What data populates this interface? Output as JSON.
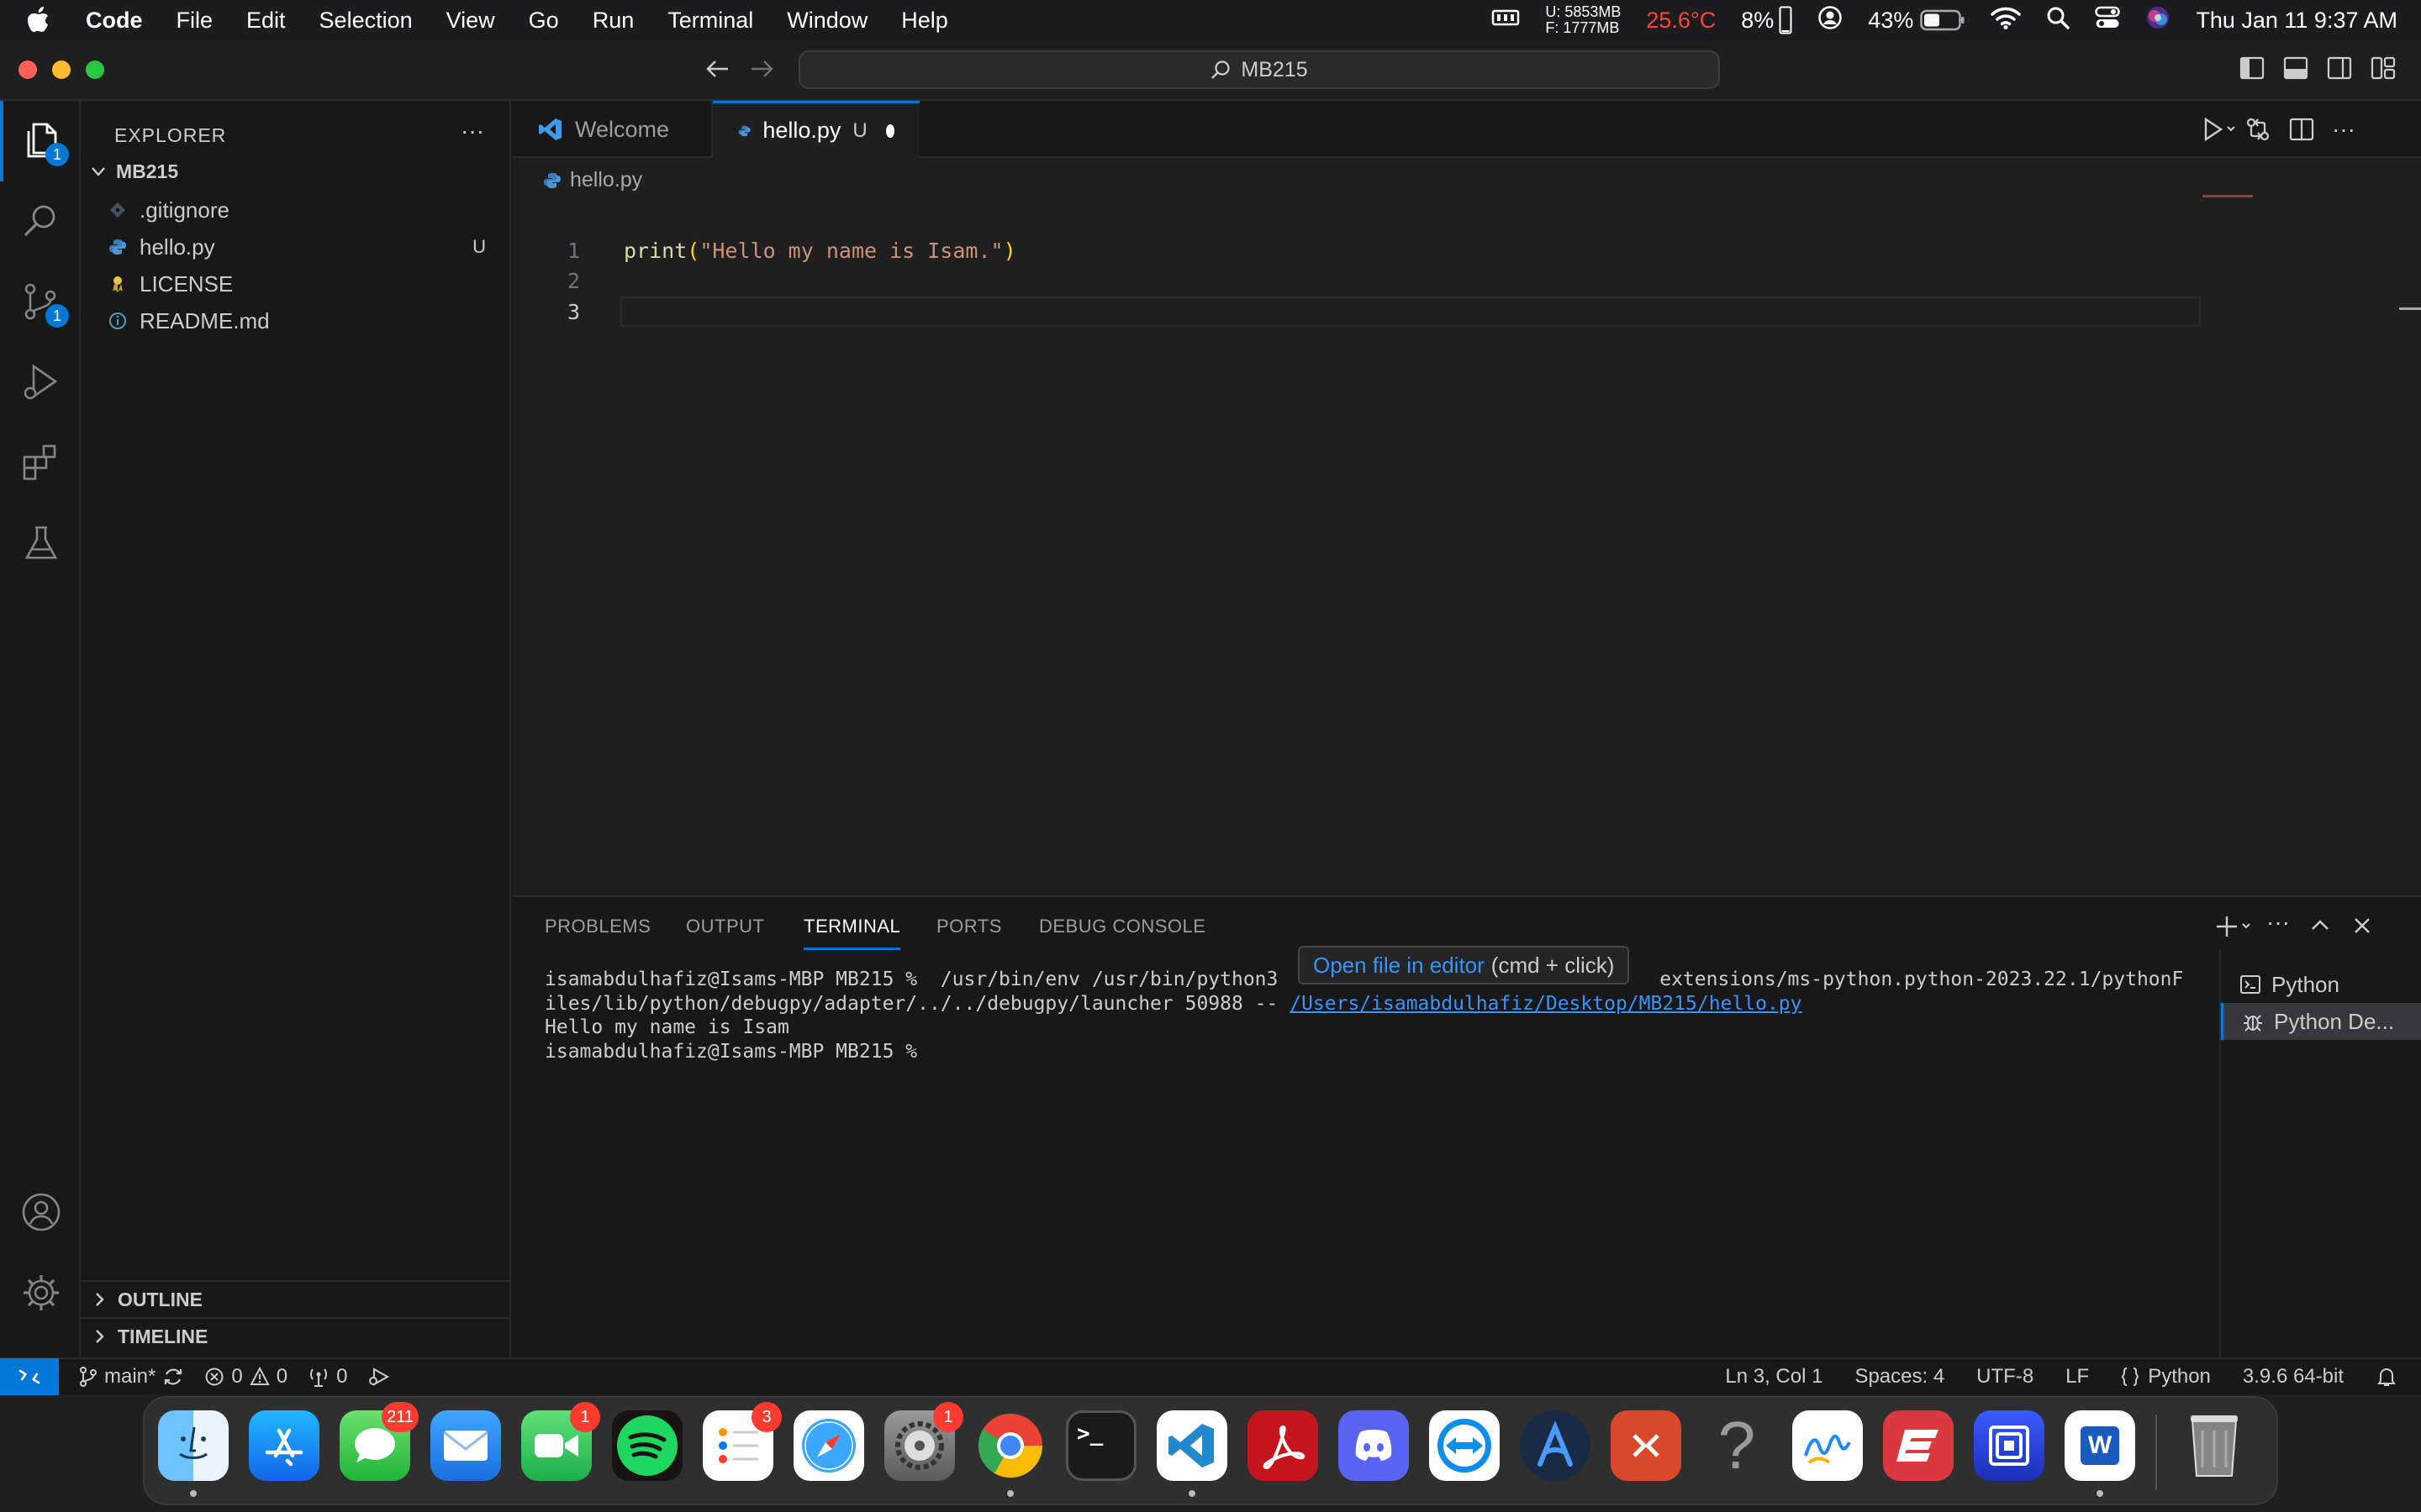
{
  "menubar": {
    "items": [
      "Code",
      "File",
      "Edit",
      "Selection",
      "View",
      "Go",
      "Run",
      "Terminal",
      "Window",
      "Help"
    ],
    "mem_used": "U: 5853MB",
    "mem_free": "F: 1777MB",
    "temperature": "25.6°C",
    "cpu": "8%",
    "battery": "43%",
    "datetime": "Thu Jan 11  9:37 AM"
  },
  "titlebar": {
    "search_text": "MB215"
  },
  "activitybar": {
    "explorer_badge": "1",
    "scm_badge": "1"
  },
  "sidebar": {
    "title": "EXPLORER",
    "more": "···",
    "folder": "MB215",
    "files": [
      {
        "name": ".gitignore",
        "status": "",
        "icon": "git-file-icon"
      },
      {
        "name": "hello.py",
        "status": "U",
        "icon": "python-file-icon"
      },
      {
        "name": "LICENSE",
        "status": "",
        "icon": "license-file-icon"
      },
      {
        "name": "README.md",
        "status": "",
        "icon": "info-file-icon"
      }
    ],
    "outline": "OUTLINE",
    "timeline": "TIMELINE"
  },
  "editor": {
    "tabs": [
      {
        "label": "Welcome",
        "status": ""
      },
      {
        "label": "hello.py",
        "status": "U"
      }
    ],
    "breadcrumb": "hello.py",
    "lines": [
      {
        "num": "1",
        "fn": "print",
        "open": "(",
        "str": "\"Hello my name is Isam.\"",
        "close": ")"
      },
      {
        "num": "2"
      },
      {
        "num": "3"
      }
    ]
  },
  "panel": {
    "tabs": [
      "PROBLEMS",
      "OUTPUT",
      "TERMINAL",
      "PORTS",
      "DEBUG CONSOLE"
    ],
    "active_tab": "TERMINAL",
    "terminal": {
      "line1_a": "isamabdulhafiz@Isams-MBP MB215 %  /usr/bin/env /usr/bin/python3 ",
      "line1_b": "extensions/ms-python.python-2023.22.1/pythonF",
      "line2_a": "iles/lib/python/debugpy/adapter/../../debugpy/launcher 50988 -- ",
      "line2_link": "/Users/isamabdulhafiz/Desktop/MB215/hello.py",
      "line3": "Hello my name is Isam",
      "line4": "isamabdulhafiz@Isams-MBP MB215 % "
    },
    "tooltip_link": "Open file in editor",
    "tooltip_hint": "(cmd + click)",
    "terminal_list": [
      "Python",
      "Python De..."
    ]
  },
  "statusbar": {
    "branch": "main*",
    "errors": "0",
    "warnings": "0",
    "ports": "0",
    "position": "Ln 3, Col 1",
    "spaces": "Spaces: 4",
    "encoding": "UTF-8",
    "eol": "LF",
    "language": "Python",
    "interpreter": "3.9.6 64-bit"
  },
  "dock": {
    "apps": [
      {
        "name": "finder",
        "badge": ""
      },
      {
        "name": "app-store",
        "badge": ""
      },
      {
        "name": "messages",
        "badge": "211"
      },
      {
        "name": "mail",
        "badge": ""
      },
      {
        "name": "facetime",
        "badge": "1"
      },
      {
        "name": "spotify",
        "badge": ""
      },
      {
        "name": "reminders",
        "badge": "3"
      },
      {
        "name": "safari",
        "badge": ""
      },
      {
        "name": "system-settings",
        "badge": "1"
      },
      {
        "name": "chrome",
        "badge": ""
      },
      {
        "name": "terminal",
        "badge": ""
      },
      {
        "name": "vscode",
        "badge": ""
      },
      {
        "name": "acrobat",
        "badge": ""
      },
      {
        "name": "discord",
        "badge": ""
      },
      {
        "name": "teamviewer",
        "badge": ""
      },
      {
        "name": "arc",
        "badge": ""
      },
      {
        "name": "remote-desktop",
        "badge": ""
      },
      {
        "name": "help",
        "badge": ""
      },
      {
        "name": "freeform",
        "badge": ""
      },
      {
        "name": "expressvpn",
        "badge": ""
      },
      {
        "name": "screens",
        "badge": ""
      },
      {
        "name": "word",
        "badge": ""
      },
      {
        "name": "trash",
        "badge": ""
      }
    ],
    "terminal_glyph": ">_",
    "help_glyph": "?",
    "word_glyph": "W"
  },
  "colors": {
    "accent": "#0078d4",
    "string": "#ce9178",
    "function": "#dcdcaa",
    "badge_red": "#ff3b30"
  }
}
